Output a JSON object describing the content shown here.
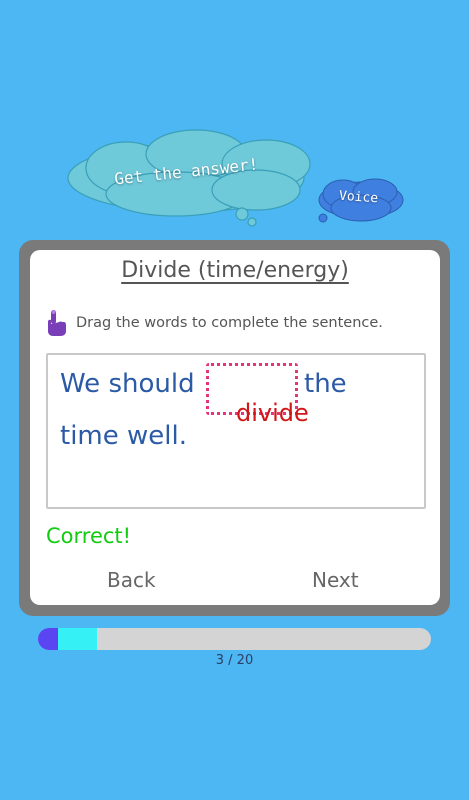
{
  "top_actions": {
    "answer_label": "Get the answer!",
    "voice_label": "Voice"
  },
  "card": {
    "title": "Divide (time/energy)",
    "instruction": "Drag the words to complete the sentence.",
    "sentence": {
      "part1": "We should",
      "part2": "the",
      "part3": "time well."
    },
    "drag_word": "divide",
    "feedback": "Correct!",
    "back_label": "Back",
    "next_label": "Next"
  },
  "progress": {
    "current": 3,
    "total": 20,
    "label": "3 / 20",
    "completed_fraction": 0.05,
    "current_fraction": 0.15
  },
  "colors": {
    "background": "#4cb7f2",
    "cloud": "#6ec9d9",
    "word_blue": "#2b5aa6",
    "drag_word_red": "#d01818",
    "slot_pink": "#e8327a",
    "correct_green": "#11cc11",
    "progress_done": "#5b45f2",
    "progress_current": "#35f0f5",
    "progress_track": "#d4d4d4"
  },
  "icons": {
    "instruction_icon": "hand-pointer-icon"
  }
}
